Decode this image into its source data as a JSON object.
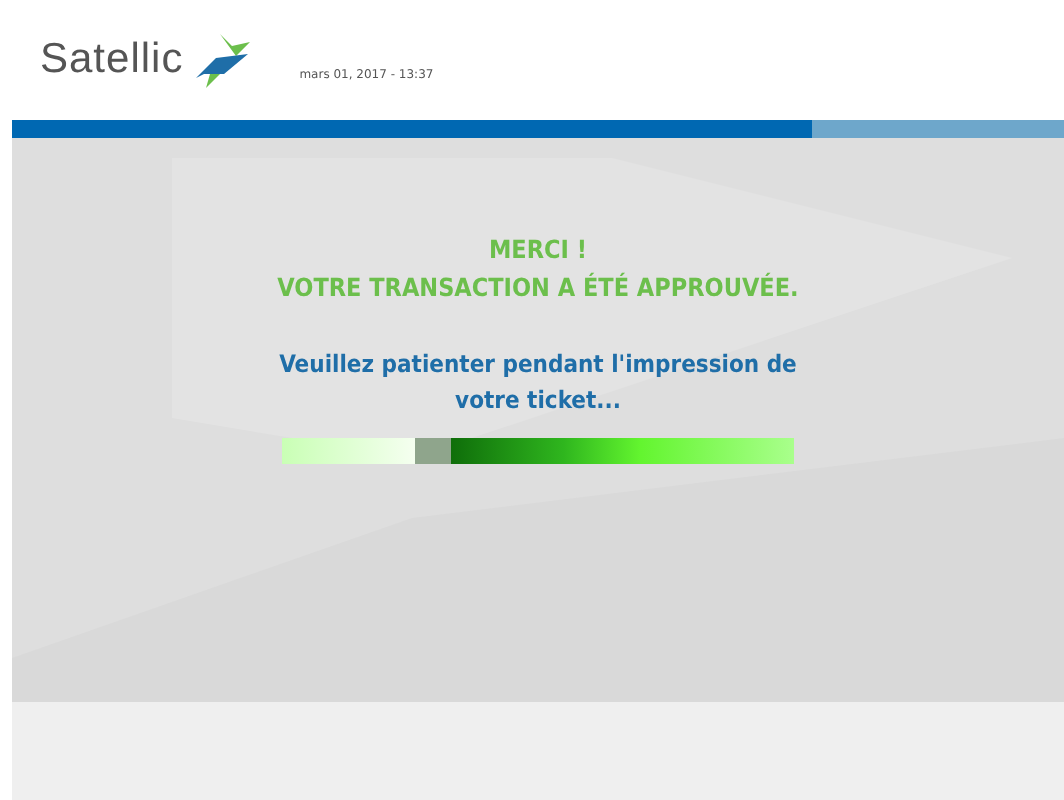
{
  "header": {
    "logo_text": "Satellic",
    "datetime": "mars 01, 2017 - 13:37"
  },
  "message": {
    "title_lines": [
      "MERCI !",
      "VOTRE TRANSACTION A ÉTÉ APPROUVÉE."
    ],
    "instruction": "Veuillez patienter pendant l'impression de votre ticket..."
  }
}
